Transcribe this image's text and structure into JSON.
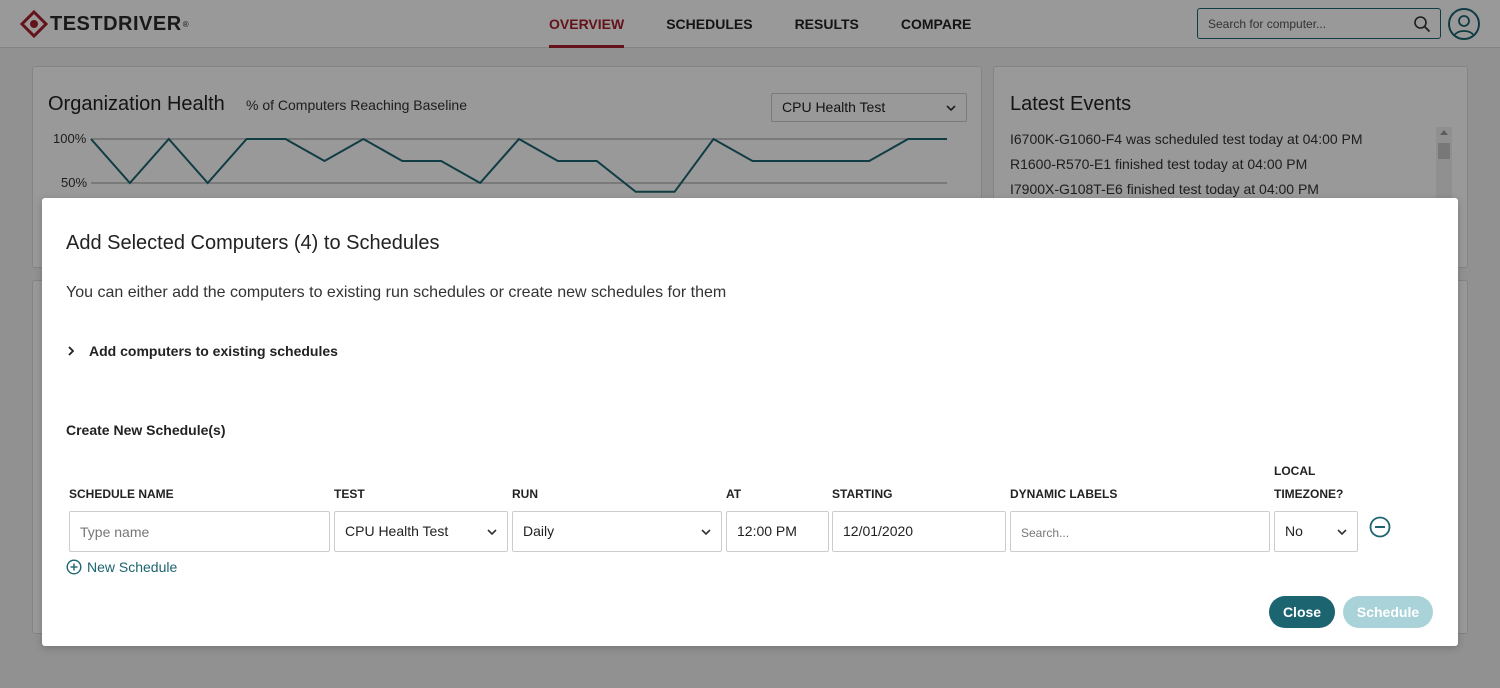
{
  "app": {
    "brand": "TESTDRIVER",
    "brand_mark": "®"
  },
  "nav": {
    "overview": "OVERVIEW",
    "schedules": "SCHEDULES",
    "results": "RESULTS",
    "compare": "COMPARE",
    "active": "OVERVIEW"
  },
  "search": {
    "placeholder": "Search for computer..."
  },
  "health": {
    "title": "Organization Health",
    "subtitle": "% of Computers Reaching Baseline",
    "test_select": "CPU Health Test",
    "y_ticks": [
      "100%",
      "50%"
    ]
  },
  "chart_data": {
    "type": "line",
    "ylim": [
      0,
      100
    ],
    "y_ticks": [
      "100%",
      "50%"
    ],
    "grid": true,
    "values": [
      100,
      50,
      100,
      50,
      100,
      100,
      75,
      100,
      75,
      75,
      50,
      100,
      75,
      75,
      40,
      40,
      100,
      75,
      75,
      75,
      75,
      100,
      100
    ]
  },
  "events": {
    "title": "Latest Events",
    "items": [
      "I6700K-G1060-F4 was scheduled test today at 04:00 PM",
      "R1600-R570-E1 finished test today at 04:00 PM",
      "I7900X-G108T-E6 finished test today at 04:00 PM"
    ]
  },
  "modal": {
    "title": "Add Selected Computers (4) to Schedules",
    "description": "You can either add the computers to existing run schedules or create new schedules for them",
    "existing_label": "Add computers to existing schedules",
    "create_title": "Create New Schedule(s)",
    "columns": {
      "name": "SCHEDULE NAME",
      "test": "TEST",
      "run": "RUN",
      "at": "AT",
      "starting": "STARTING",
      "labels": "DYNAMIC LABELS",
      "local_line1": "LOCAL",
      "local_line2": "TIMEZONE?"
    },
    "row": {
      "name_placeholder": "Type name",
      "test": "CPU Health Test",
      "run": "Daily",
      "at": "12:00 PM",
      "starting": "12/01/2020",
      "labels_placeholder": "Search...",
      "local": "No"
    },
    "new_schedule_label": "New Schedule",
    "close_label": "Close",
    "schedule_label": "Schedule"
  },
  "colors": {
    "accent": "#1c6470",
    "brand_red": "#a8202c",
    "disabled_button": "#a9d3d8"
  }
}
